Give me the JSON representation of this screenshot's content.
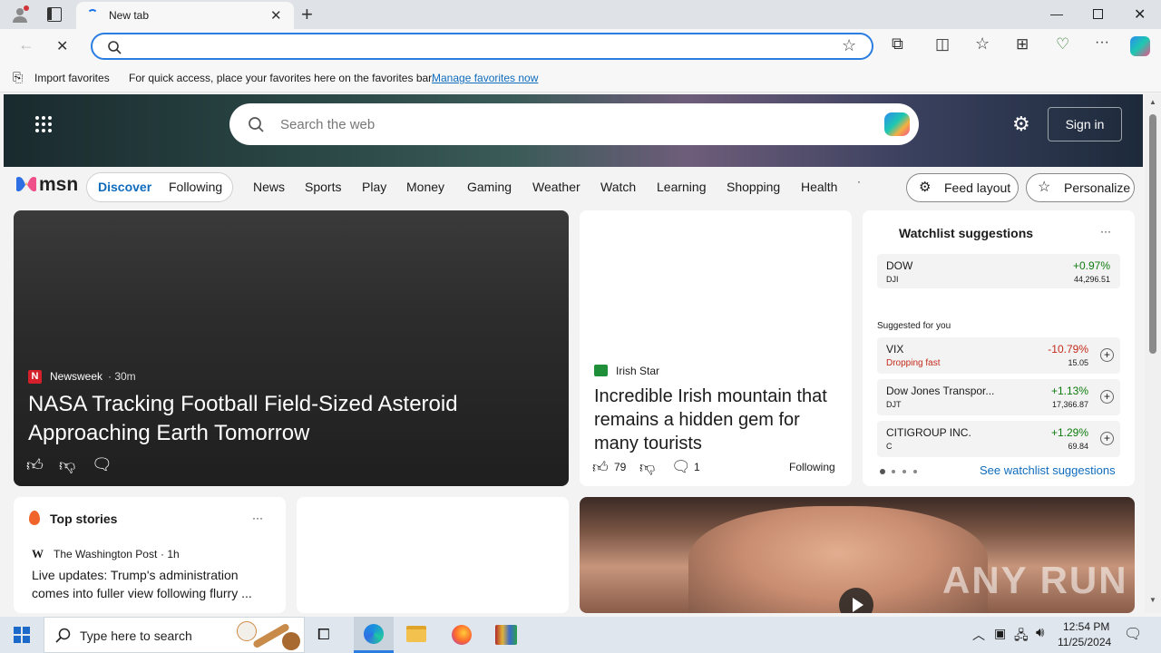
{
  "tab": {
    "title": "New tab"
  },
  "address": {
    "value": ""
  },
  "favbar": {
    "import_label": "Import favorites",
    "hint": "For quick access, place your favorites here on the favorites bar.",
    "manage_link": "Manage favorites now"
  },
  "msn": {
    "search_placeholder": "Search the web",
    "sign_in": "Sign in",
    "logo_text": "msn",
    "tabs": [
      "Discover",
      "Following"
    ],
    "nav": [
      "News",
      "Sports",
      "Play",
      "Money",
      "Gaming",
      "Weather",
      "Watch",
      "Learning",
      "Shopping",
      "Health"
    ],
    "feed_layout": "Feed layout",
    "personalize": "Personalize"
  },
  "hero_card": {
    "source": "Newsweek",
    "time": "· 30m",
    "headline": "NASA Tracking Football Field-Sized Asteroid Approaching Earth Tomorrow"
  },
  "irish_card": {
    "source": "Irish Star",
    "headline": "Incredible Irish mountain that remains a hidden gem for many tourists",
    "likes": "79",
    "comments": "1",
    "following": "Following"
  },
  "watchlist": {
    "title": "Watchlist suggestions",
    "more": "···",
    "dow": {
      "name": "DOW",
      "ticker": "DJI",
      "change": "+0.97%",
      "price": "44,296.51"
    },
    "suggested_label": "Suggested for you",
    "items": [
      {
        "name": "VIX",
        "sub": "Dropping fast",
        "change": "-10.79%",
        "price": "15.05"
      },
      {
        "name": "Dow Jones Transpor...",
        "sub": "DJT",
        "change": "+1.13%",
        "price": "17,366.87"
      },
      {
        "name": "CITIGROUP INC.",
        "sub": "C",
        "change": "+1.29%",
        "price": "69.84"
      }
    ],
    "see_link": "See watchlist suggestions"
  },
  "top_stories": {
    "title": "Top stories",
    "more": "···",
    "source": "The Washington Post",
    "time": "· 1h",
    "headline": "Live updates: Trump's administration comes into fuller view following flurry ..."
  },
  "watermark": "ANY RUN",
  "taskbar": {
    "search_placeholder": "Type here to search",
    "time": "12:54 PM",
    "date": "11/25/2024"
  },
  "colors": {
    "accent": "#0f6cbd",
    "gain": "#0f7b0f",
    "loss": "#c42b1c"
  }
}
